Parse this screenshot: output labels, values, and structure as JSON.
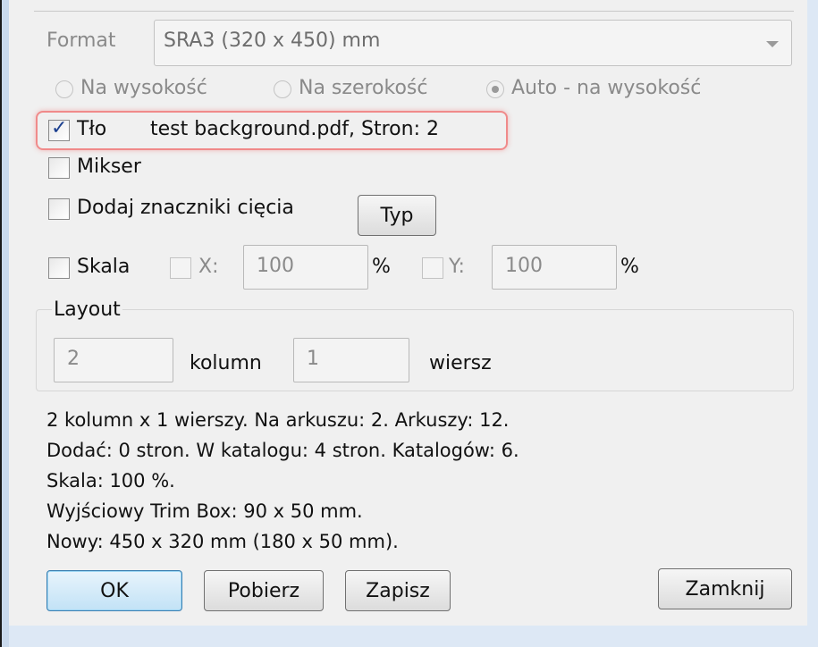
{
  "format": {
    "label": "Format",
    "value": "SRA3 (320 x 450) mm"
  },
  "orientation": {
    "options": [
      "Na wysokość",
      "Na szerokość",
      "Auto - na wysokość"
    ],
    "selected": "Auto - na wysokość"
  },
  "background": {
    "label": "Tło",
    "checked": true,
    "file_info": "test background.pdf, Stron: 2"
  },
  "mixer": {
    "label": "Mikser",
    "checked": false
  },
  "cut_marks": {
    "label": "Dodaj znaczniki cięcia",
    "checked": false,
    "type_button": "Typ"
  },
  "scale": {
    "label": "Skala",
    "checked": false,
    "x_label": "X:",
    "x_value": "100",
    "x_unit": "%",
    "y_label": "Y:",
    "y_value": "100",
    "y_unit": "%"
  },
  "layout": {
    "legend": "Layout",
    "columns_value": "2",
    "columns_label": "kolumn",
    "rows_value": "1",
    "rows_label": "wiersz"
  },
  "info_lines": [
    "2 kolumn x 1 wierszy. Na arkuszu: 2. Arkuszy: 12.",
    "Dodać: 0 stron. W katalogu: 4 stron. Katalogów: 6.",
    "Skala: 100 %.",
    "Wyjściowy Trim Box: 90 x 50 mm.",
    "Nowy: 450 x 320 mm (180 x 50 mm)."
  ],
  "buttons": {
    "ok": "OK",
    "load": "Pobierz",
    "save": "Zapisz",
    "close": "Zamknij"
  },
  "colors": {
    "highlight": "#f08a8a",
    "check": "#1b3f8f",
    "window_bg": "#f0f0f0"
  }
}
